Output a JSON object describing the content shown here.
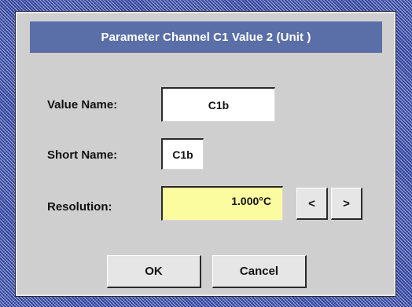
{
  "dialog": {
    "title": "Parameter Channel C1 Value 2 (Unit  )",
    "value_name": {
      "label": "Value Name:",
      "value": "C1b"
    },
    "short_name": {
      "label": "Short Name:",
      "value": "C1b"
    },
    "resolution": {
      "label": "Resolution:",
      "value": "1.000°C",
      "decrease_label": "<",
      "increase_label": ">"
    },
    "ok_label": "OK",
    "cancel_label": "Cancel"
  },
  "colors": {
    "title_bar": "#5a6fa8",
    "dialog_bg": "#cfcfcf",
    "resolution_field_bg": "#fbfba0"
  }
}
